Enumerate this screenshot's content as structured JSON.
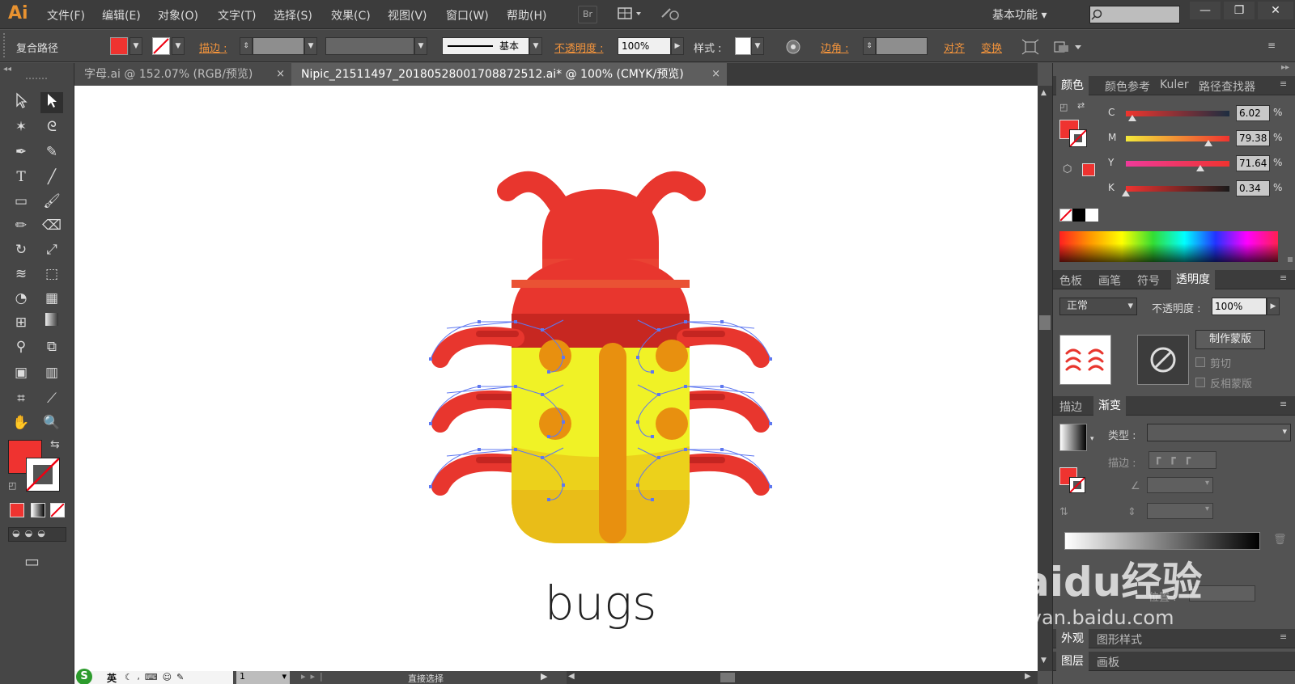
{
  "app": {
    "logo": "Ai"
  },
  "menu": [
    "文件(F)",
    "编辑(E)",
    "对象(O)",
    "文字(T)",
    "选择(S)",
    "效果(C)",
    "视图(V)",
    "窗口(W)",
    "帮助(H)"
  ],
  "menu_extra": {
    "bridge": "Br"
  },
  "workspace": {
    "label": "基本功能"
  },
  "window_controls": {
    "minimize": "—",
    "restore": "❐",
    "close": "✕"
  },
  "control_bar": {
    "selection_type": "复合路径",
    "stroke_label": "描边 :",
    "stroke_style": "基本",
    "opacity_label": "不透明度 :",
    "opacity_value": "100%",
    "style_label": "样式 :",
    "corner_label": "边角 :",
    "align_label": "对齐",
    "transform_label": "变换",
    "fill_color": "#ef3330"
  },
  "tabs": [
    {
      "label": "字母.ai @ 152.07% (RGB/预览)",
      "close": "×",
      "active": false
    },
    {
      "label": "Nipic_21511497_20180528001708872512.ai* @ 100% (CMYK/预览)",
      "close": "×",
      "active": true
    }
  ],
  "artwork": {
    "caption": "bugs"
  },
  "status_bar": {
    "zoom": "1",
    "tool": "直接选择"
  },
  "color_panel": {
    "tabs": [
      "颜色",
      "颜色参考",
      "Kuler",
      "路径查找器"
    ],
    "channels": [
      {
        "key": "C",
        "value": "6.02",
        "pct": "%",
        "level": 0.0602
      },
      {
        "key": "M",
        "value": "79.38",
        "pct": "%",
        "level": 0.7938
      },
      {
        "key": "Y",
        "value": "71.64",
        "pct": "%",
        "level": 0.7164
      },
      {
        "key": "K",
        "value": "0.34",
        "pct": "%",
        "level": 0.0034
      }
    ]
  },
  "transparency_panel": {
    "tabs": [
      "色板",
      "画笔",
      "符号",
      "透明度"
    ],
    "blend_mode": "正常",
    "opacity_label": "不透明度 :",
    "opacity_value": "100%",
    "make_mask": "制作蒙版",
    "clip": "剪切",
    "invert_mask": "反相蒙版"
  },
  "gradient_panel": {
    "tabs": [
      "描边",
      "渐变"
    ],
    "type_label": "类型 :",
    "stroke_label": "描边 :",
    "position_label": "位置 :"
  },
  "appearance_panel": {
    "tabs": [
      "外观",
      "图形样式"
    ]
  },
  "layers_panel": {
    "tabs": [
      "图层",
      "画板"
    ]
  },
  "ime": {
    "mode": "英"
  },
  "watermark": {
    "text": "Baidu经验",
    "url": "jingyan.baidu.com"
  }
}
